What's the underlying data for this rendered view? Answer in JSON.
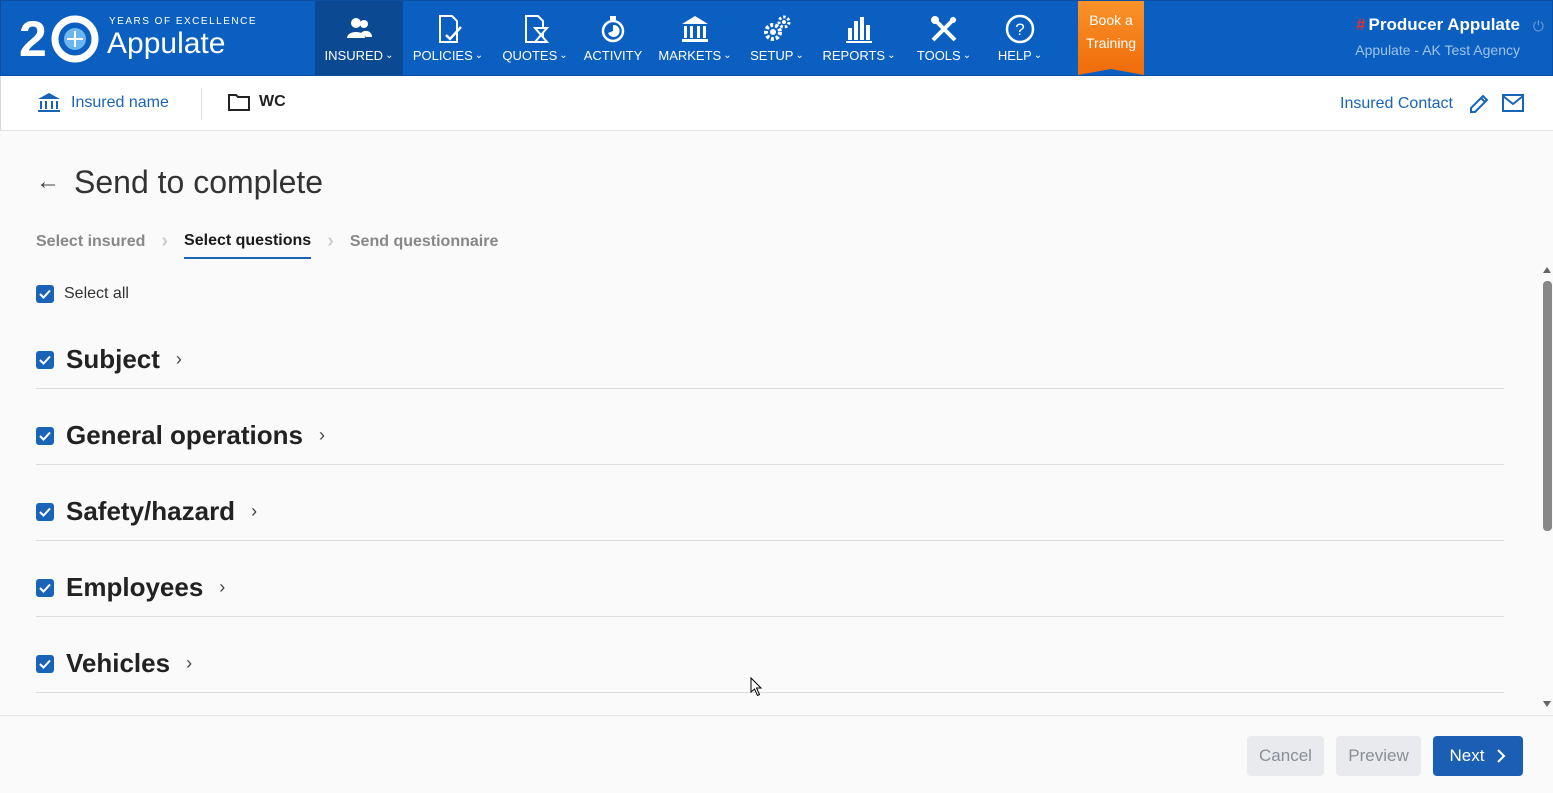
{
  "brand": {
    "years_tag": "YEARS OF EXCELLENCE",
    "name": "Appulate",
    "number": "2"
  },
  "nav": [
    {
      "label": "INSURED",
      "icon": "users-icon",
      "dropdown": true,
      "active": true
    },
    {
      "label": "POLICIES",
      "icon": "policy-check-icon",
      "dropdown": true
    },
    {
      "label": "QUOTES",
      "icon": "quote-hourglass-icon",
      "dropdown": true
    },
    {
      "label": "ACTIVITY",
      "icon": "activity-timer-icon",
      "dropdown": false
    },
    {
      "label": "MARKETS",
      "icon": "bank-icon",
      "dropdown": true
    },
    {
      "label": "SETUP",
      "icon": "gears-icon",
      "dropdown": true
    },
    {
      "label": "REPORTS",
      "icon": "bar-chart-icon",
      "dropdown": true
    },
    {
      "label": "TOOLS",
      "icon": "wrench-screwdriver-icon",
      "dropdown": true
    },
    {
      "label": "HELP",
      "icon": "question-circle-icon",
      "dropdown": true
    }
  ],
  "book_training": {
    "line1": "Book a",
    "line2": "Training"
  },
  "user": {
    "hash": "#",
    "name": "Producer Appulate",
    "agency": "Appulate - AK Test Agency"
  },
  "subheader": {
    "insured_name": "Insured name",
    "folder": "WC",
    "insured_contact": "Insured Contact"
  },
  "page": {
    "title": "Send to complete",
    "steps": [
      "Select insured",
      "Select questions",
      "Send questionnaire"
    ],
    "active_step": 1,
    "select_all": "Select all",
    "sections": [
      "Subject",
      "General operations",
      "Safety/hazard",
      "Employees",
      "Vehicles"
    ]
  },
  "footer": {
    "cancel": "Cancel",
    "preview": "Preview",
    "next": "Next"
  },
  "colors": {
    "nav_bg": "#0a5fc0",
    "accent": "#1a64b8",
    "training": "#f58220"
  }
}
